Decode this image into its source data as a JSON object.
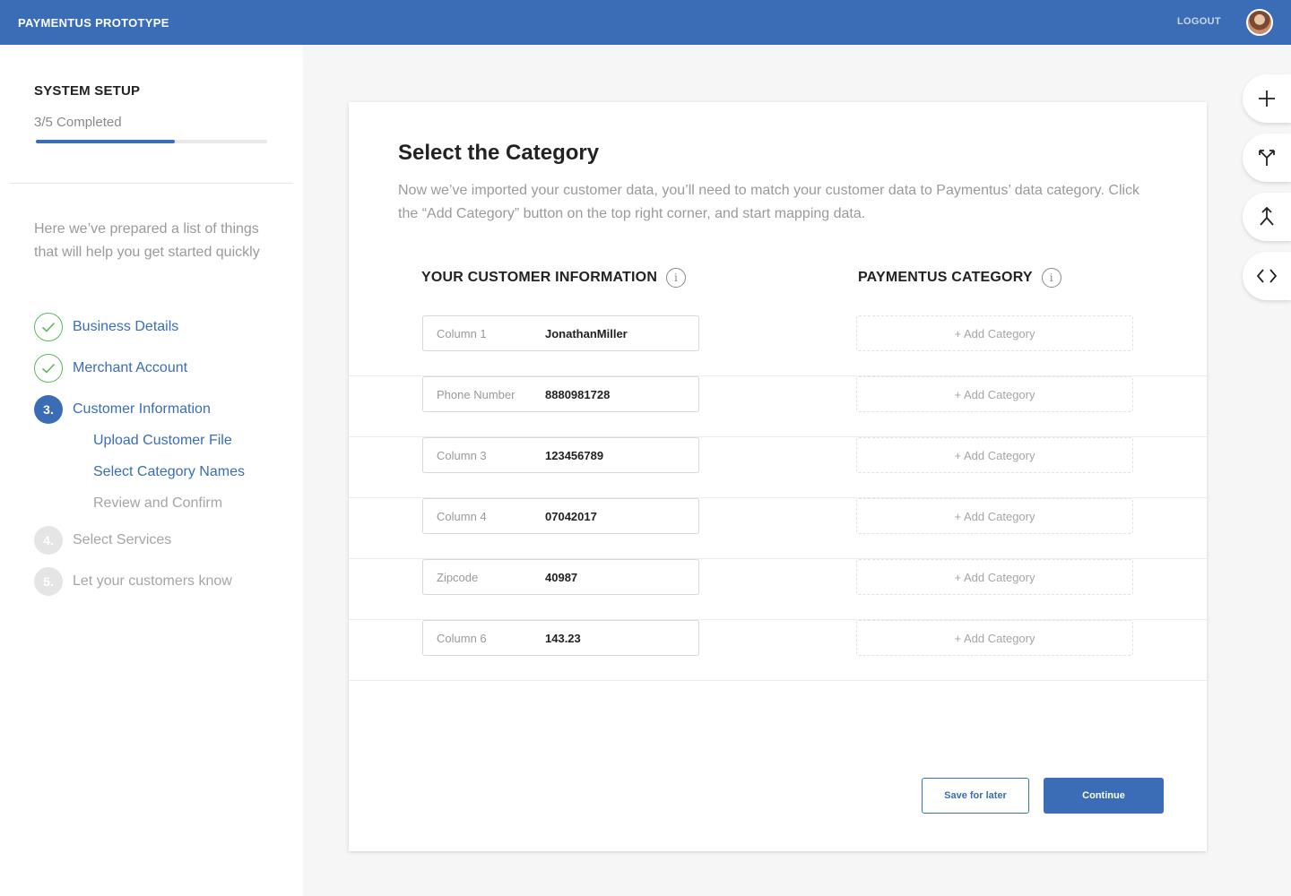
{
  "header": {
    "brand": "PAYMENTUS PROTOTYPE",
    "logout_label": "LOGOUT"
  },
  "sidebar": {
    "title": "SYSTEM SETUP",
    "progress_text": "3/5 Completed",
    "progress_fraction": 0.6,
    "intro": "Here we’ve prepared a list of things that will help you get started quickly",
    "steps": [
      {
        "badge": "",
        "label": "Business Details",
        "state": "done"
      },
      {
        "badge": "",
        "label": "Merchant Account",
        "state": "done"
      },
      {
        "badge": "3.",
        "label": "Customer Information",
        "state": "current"
      },
      {
        "badge": "4.",
        "label": "Select Services",
        "state": "todo"
      },
      {
        "badge": "5.",
        "label": "Let your customers know",
        "state": "todo"
      }
    ],
    "sub_steps": [
      {
        "label": "Upload Customer File",
        "state": "active"
      },
      {
        "label": "Select Category Names",
        "state": "active"
      },
      {
        "label": "Review and Confirm",
        "state": "todo"
      }
    ]
  },
  "main": {
    "title": "Select the Category",
    "description": "Now we’ve imported your customer data, you’ll need to match your customer data to Paymentus’ data category. Click the “Add Category” button on the top right corner, and start mapping data.",
    "col_customer": "YOUR CUSTOMER INFORMATION",
    "col_category": "PAYMENTUS CATEGORY",
    "info_glyph": "i",
    "rows": [
      {
        "label": "Column 1",
        "value": "JonathanMiller",
        "category": "+ Add Category"
      },
      {
        "label": "Phone Number",
        "value": "8880981728",
        "category": "+ Add Category"
      },
      {
        "label": "Column 3",
        "value": "123456789",
        "category": "+ Add Category"
      },
      {
        "label": "Column 4",
        "value": "07042017",
        "category": "+ Add Category"
      },
      {
        "label": "Zipcode",
        "value": "40987",
        "category": "+ Add Category"
      },
      {
        "label": "Column 6",
        "value": "143.23",
        "category": "+ Add Category"
      }
    ],
    "save_label": "Save for later",
    "continue_label": "Continue"
  },
  "tools": [
    {
      "icon": "plus-icon"
    },
    {
      "icon": "split-icon"
    },
    {
      "icon": "merge-icon"
    },
    {
      "icon": "code-icon"
    }
  ],
  "colors": {
    "brand": "#3a6db5",
    "success": "#5cb85c"
  }
}
